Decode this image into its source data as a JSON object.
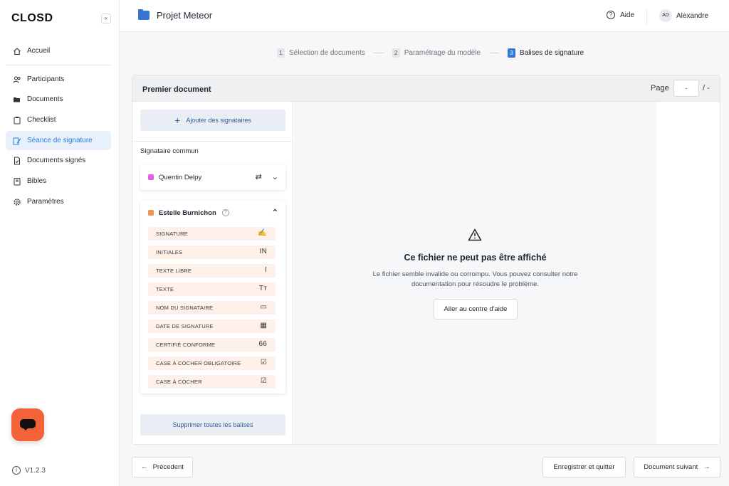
{
  "sidebar": {
    "logo": "CLOSD",
    "collapse_glyph": "«",
    "items": [
      {
        "label": "Accueil",
        "icon": "home-icon"
      },
      {
        "label": "Participants",
        "icon": "users-icon"
      },
      {
        "label": "Documents",
        "icon": "folder-open-icon"
      },
      {
        "label": "Checklist",
        "icon": "clipboard-icon"
      },
      {
        "label": "Séance de signature",
        "icon": "signature-pen-icon",
        "active": true
      },
      {
        "label": "Documents signés",
        "icon": "signed-document-icon"
      },
      {
        "label": "Bibles",
        "icon": "book-icon"
      },
      {
        "label": "Paramètres",
        "icon": "gear-icon"
      }
    ],
    "version": "V1.2.3"
  },
  "header": {
    "project": "Projet Meteor",
    "help": "Aide",
    "user_initials": "AD",
    "user_name": "Alexandre"
  },
  "steps": [
    {
      "num": "1",
      "label": "Sélection de documents"
    },
    {
      "num": "2",
      "label": "Paramétrage du modèle"
    },
    {
      "num": "3",
      "label": "Balises de signature",
      "active": true
    }
  ],
  "panel": {
    "title": "Premier document",
    "page_label": "Page",
    "page_value": "-",
    "page_total": "/ -"
  },
  "signers": {
    "add_label": "Ajouter des signataires",
    "common_label": "Signataire commun",
    "remove_all": "Supprimer toutes les balises",
    "list": [
      {
        "name": "Quentin Delpy",
        "color": "#e25ee9",
        "expanded": false
      },
      {
        "name": "Estelle Burnichon",
        "color": "#f39350",
        "expanded": true
      }
    ],
    "tags": [
      {
        "label": "SIGNATURE",
        "icon": "signature-icon",
        "glyph": "✍"
      },
      {
        "label": "INITIALES",
        "icon": "initials-icon",
        "glyph": "IN"
      },
      {
        "label": "TEXTE LIBRE",
        "icon": "text-cursor-icon",
        "glyph": "I"
      },
      {
        "label": "TEXTE",
        "icon": "text-format-icon",
        "glyph": "Tт"
      },
      {
        "label": "NOM DU SIGNATAIRE",
        "icon": "id-card-icon",
        "glyph": "▭"
      },
      {
        "label": "DATE DE SIGNATURE",
        "icon": "calendar-icon",
        "glyph": "▦"
      },
      {
        "label": "CERTIFIÉ CONFORME",
        "icon": "quote-icon",
        "glyph": "66"
      },
      {
        "label": "CASE À COCHER OBLIGATOIRE",
        "icon": "checkbox-icon",
        "glyph": "☑"
      },
      {
        "label": "CASE À COCHER",
        "icon": "checkbox-icon",
        "glyph": "☑"
      }
    ]
  },
  "viewer": {
    "error_title": "Ce fichier ne peut pas être affiché",
    "error_line1": "Le fichier semble invalide ou corrompu. Vous pouvez consulter notre",
    "error_line2": "documentation pour résoudre le problème.",
    "help_button": "Aller au centre d'aide"
  },
  "footer": {
    "previous": "Précedent",
    "save_quit": "Enregistrer et quitter",
    "next_doc": "Document suivant"
  }
}
